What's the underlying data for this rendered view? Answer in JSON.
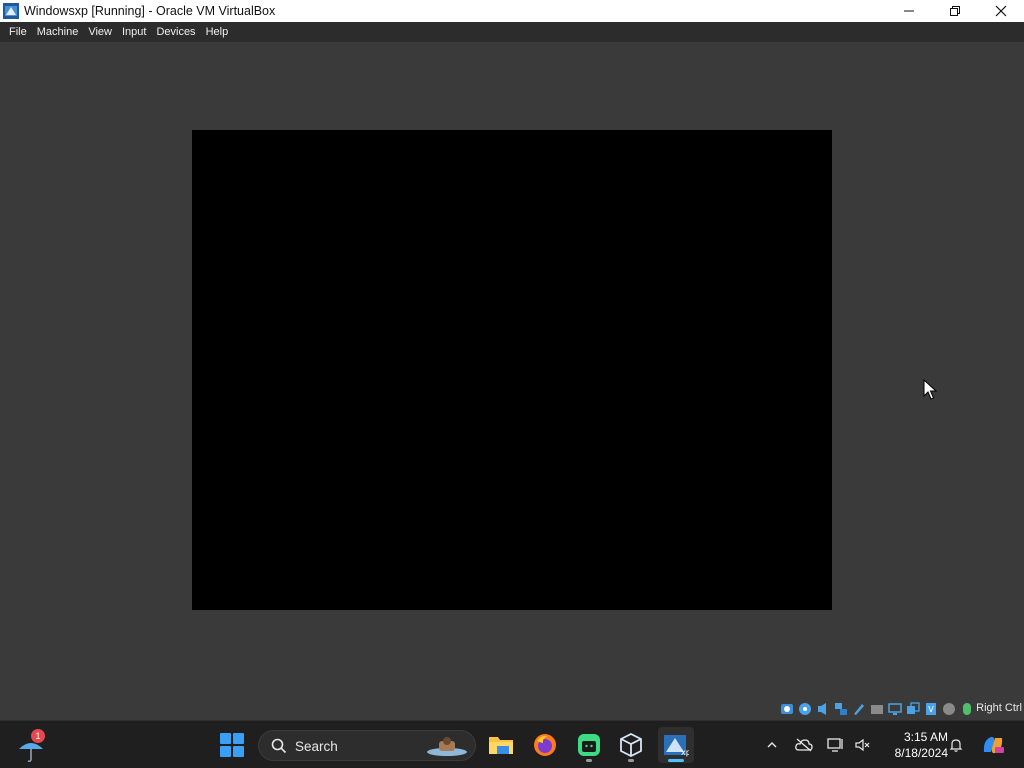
{
  "window": {
    "title": "Windowsxp [Running] - Oracle VM VirtualBox"
  },
  "menu": {
    "items": [
      {
        "label": "File"
      },
      {
        "label": "Machine"
      },
      {
        "label": "View"
      },
      {
        "label": "Input"
      },
      {
        "label": "Devices"
      },
      {
        "label": "Help"
      }
    ]
  },
  "statusbar": {
    "host_key": "Right Ctrl",
    "icons": [
      "hard-disk-icon",
      "optical-drive-icon",
      "audio-icon",
      "network-icon",
      "usb-icon",
      "shared-folders-icon",
      "display-icon",
      "video-capture-icon",
      "recording-icon",
      "cpu-icon",
      "mouse-integration-icon",
      "keyboard-icon"
    ]
  },
  "taskbar": {
    "weather_badge": "1",
    "search_placeholder": "Search",
    "apps": [
      "file-explorer-icon",
      "firefox-icon",
      "android-app-icon",
      "virtualbox-icon",
      "windowsxp-vm-icon"
    ]
  },
  "clock": {
    "time": "3:15 AM",
    "date": "8/18/2024"
  },
  "colors": {
    "accent": "#4cc2ff",
    "vm_screen": "#000000",
    "badge": "#e8474f"
  }
}
